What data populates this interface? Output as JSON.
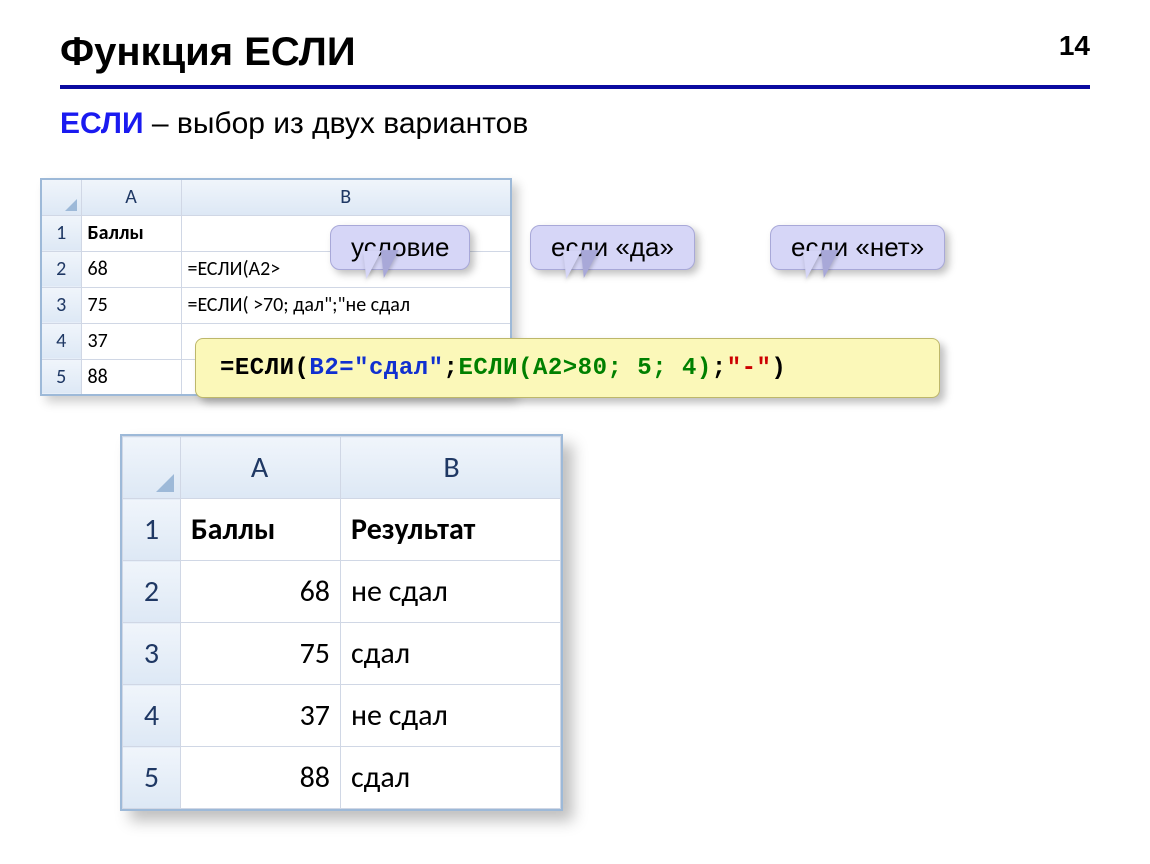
{
  "page_number": "14",
  "title": "Функция ЕСЛИ",
  "subtitle_keyword": "ЕСЛИ",
  "subtitle_rest": " – выбор из двух вариантов",
  "sheet1": {
    "col_headers": [
      "A",
      "B"
    ],
    "row_headers": [
      "1",
      "2",
      "3",
      "4",
      "5"
    ],
    "rows": [
      {
        "a": "Баллы",
        "b": ""
      },
      {
        "a": "68",
        "b": "=ЕСЛИ(A2>"
      },
      {
        "a": "75",
        "b": "=ЕСЛИ(     >70;    дал\";\"не сдал"
      },
      {
        "a": "37",
        "b": ""
      },
      {
        "a": "88",
        "b": ""
      }
    ]
  },
  "callouts": {
    "condition": "условие",
    "if_yes": "если «да»",
    "if_no": "если «нет»"
  },
  "formula": {
    "p1": "=ЕСЛИ(",
    "p2": "B2=\"сдал\"",
    "p3": "; ",
    "p4": "ЕСЛИ(A2>80; 5; 4)",
    "p5": "; ",
    "p6": "\"-\"",
    "p7": ")"
  },
  "sheet2": {
    "col_headers": [
      "A",
      "B"
    ],
    "row_headers": [
      "1",
      "2",
      "3",
      "4",
      "5"
    ],
    "header_row": {
      "a": "Баллы",
      "b": "Результат"
    },
    "data": [
      {
        "a": "68",
        "b": "не сдал"
      },
      {
        "a": "75",
        "b": "сдал"
      },
      {
        "a": "37",
        "b": "не сдал"
      },
      {
        "a": "88",
        "b": "сдал"
      }
    ]
  }
}
